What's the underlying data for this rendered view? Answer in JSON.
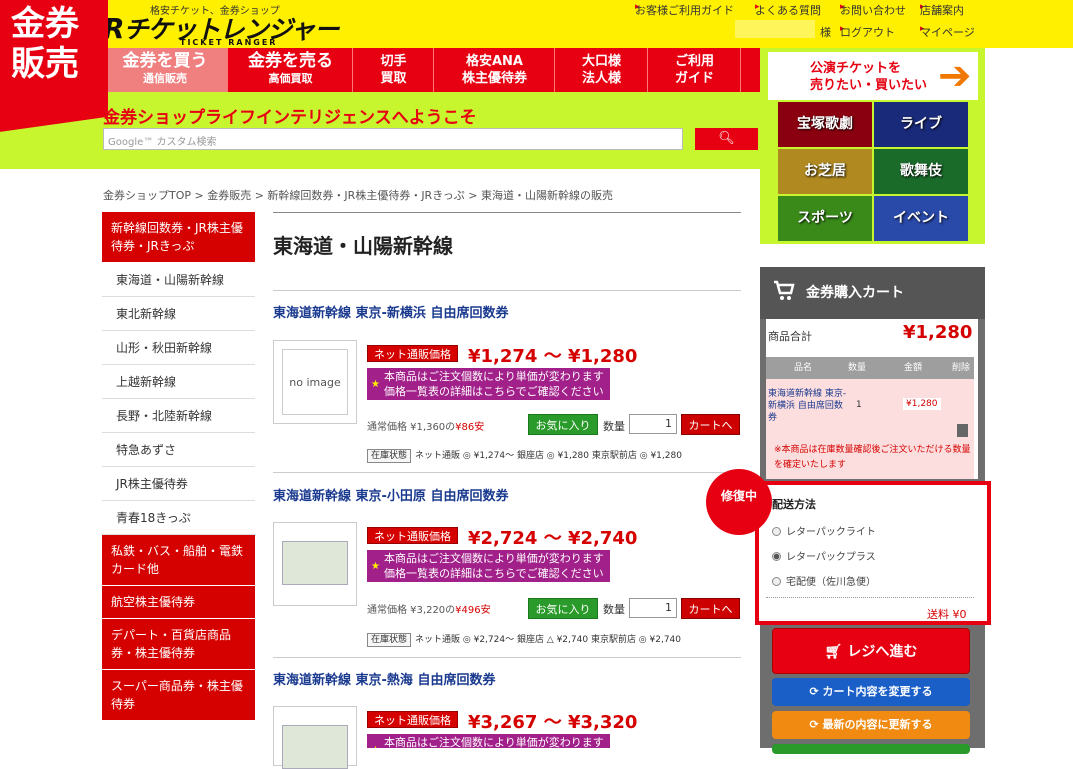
{
  "corner_label": "金券\n販売",
  "header": {
    "logo_sub": "格安チケット、金券ショップ",
    "logo": "チケットレンジャー",
    "logo_en": "TICKET RANGER",
    "links": [
      "お客様ご利用ガイド",
      "よくある質問",
      "お問い合わせ",
      "店舗案内"
    ],
    "user_links": [
      "様",
      "ログアウト",
      "マイページ"
    ]
  },
  "nav": [
    {
      "big": "金券を買う",
      "sm": "通信販売"
    },
    {
      "big": "金券を売る",
      "sm": "高価買取"
    },
    {
      "big": "切手",
      "sm": "買取"
    },
    {
      "big": "格安ANA",
      "sm": "株主優待券"
    },
    {
      "big": "大口様",
      "sm": "法人様"
    },
    {
      "big": "ご利用",
      "sm": "ガイド"
    }
  ],
  "welcome": "金券ショップライフインテリジェンスへようこそ",
  "search": {
    "placeholder": "Google™ カスタム検索"
  },
  "banner": {
    "head": "公演チケットを\n売りたい・買いたい",
    "tiles": [
      "宝塚歌劇",
      "ライブ",
      "お芝居",
      "歌舞伎",
      "スポーツ",
      "イベント"
    ]
  },
  "breadcrumb": "金券ショップTOP > 金券販売 > 新幹線回数券・JR株主優待券・JRきっぷ > 東海道・山陽新幹線の販売",
  "left_menu": [
    {
      "label": "新幹線回数券・JR株主優待券・JRきっぷ",
      "type": "red"
    },
    {
      "label": "東海道・山陽新幹線",
      "type": "sub"
    },
    {
      "label": "東北新幹線",
      "type": "sub"
    },
    {
      "label": "山形・秋田新幹線",
      "type": "sub"
    },
    {
      "label": "上越新幹線",
      "type": "sub"
    },
    {
      "label": "長野・北陸新幹線",
      "type": "sub"
    },
    {
      "label": "特急あずさ",
      "type": "sub"
    },
    {
      "label": "JR株主優待券",
      "type": "sub"
    },
    {
      "label": "青春18きっぷ",
      "type": "sub"
    },
    {
      "label": "私鉄・バス・船舶・電鉄カード他",
      "type": "red"
    },
    {
      "label": "航空株主優待券",
      "type": "red"
    },
    {
      "label": "デパート・百貨店商品券・株主優待券",
      "type": "red"
    },
    {
      "label": "スーパー商品券・株主優待券",
      "type": "red"
    }
  ],
  "page_title": "東海道・山陽新幹線",
  "labels": {
    "net_price": "ネット通販価格",
    "notice1": "本商品はご注文個数により単価が変わります",
    "notice2": "価格一覧表の詳細はこちらでご確認ください",
    "fav": "お気に入り",
    "qty": "数量",
    "cart": "カートへ",
    "stock": "在庫状態",
    "no_image": "no image"
  },
  "products": [
    {
      "title": "東海道新幹線 東京-新横浜 自由席回数券",
      "price": "¥1,274 ～ ¥1,280",
      "regular": "通常価格 ¥1,360の",
      "discount": "¥86安",
      "qty": "1",
      "stock": "ネット通販 ◎ ¥1,274〜 銀座店 ◎ ¥1,280 東京駅前店 ◎ ¥1,280"
    },
    {
      "title": "東海道新幹線 東京-小田原 自由席回数券",
      "price": "¥2,724 ～ ¥2,740",
      "regular": "通常価格 ¥3,220の",
      "discount": "¥496安",
      "qty": "1",
      "stock": "ネット通販 ◎ ¥2,724〜 銀座店 △ ¥2,740 東京駅前店 ◎ ¥2,740"
    },
    {
      "title": "東海道新幹線 東京-熱海 自由席回数券",
      "price": "¥3,267 ～ ¥3,320"
    }
  ],
  "cart": {
    "title": "金券購入カート",
    "total_label": "商品合計",
    "total": "¥1,280",
    "headers": [
      "品名",
      "数量",
      "金額",
      "削除"
    ],
    "item_name": "東海道新幹線 東京-新横浜 自由席回数券",
    "item_qty": "1",
    "item_price": "¥1,280",
    "warning": "※本商品は在庫数量確認後ご注文いただける数量を確定いたします",
    "ship_title": "配送方法",
    "ship_options": [
      "レターパックライト",
      "レターパックプラス",
      "宅配便（佐川急便）"
    ],
    "ship_selected": 1,
    "ship_fee": "送料 ¥0",
    "repair": "修復中",
    "checkout": "レジへ進む",
    "change": "カート内容を変更する",
    "refresh": "最新の内容に更新する"
  },
  "colors": {
    "red": "#e60012",
    "yellow": "#fff000",
    "green": "#c7f52e",
    "purple": "#a2208a"
  }
}
